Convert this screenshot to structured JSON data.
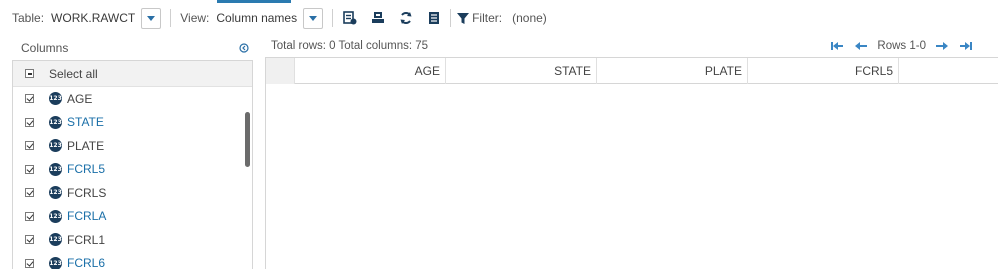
{
  "toolbar": {
    "table_label": "Table:",
    "table_value": "WORK.RAWCT",
    "view_label": "View:",
    "view_value": "Column names",
    "filter_label": "Filter:",
    "filter_value": "(none)"
  },
  "columns_panel": {
    "title": "Columns",
    "select_all": "Select all",
    "items": [
      {
        "label": "AGE",
        "badge": "123",
        "color": "dark"
      },
      {
        "label": "STATE",
        "badge": "123",
        "color": "blue"
      },
      {
        "label": "PLATE",
        "badge": "123",
        "color": "dark"
      },
      {
        "label": "FCRL5",
        "badge": "123",
        "color": "blue"
      },
      {
        "label": "FCRLS",
        "badge": "123",
        "color": "dark"
      },
      {
        "label": "FCRLA",
        "badge": "123",
        "color": "blue"
      },
      {
        "label": "FCRL1",
        "badge": "123",
        "color": "dark"
      },
      {
        "label": "FCRL6",
        "badge": "123",
        "color": "blue"
      }
    ]
  },
  "grid": {
    "summary": "Total rows: 0  Total columns: 75",
    "rows_label": "Rows 1-0",
    "headers": [
      "AGE",
      "STATE",
      "PLATE",
      "FCRL5"
    ]
  },
  "colors": {
    "accent": "#2a7ab0",
    "link_blue": "#1a6fa8",
    "badge": "#1b3d5c"
  }
}
